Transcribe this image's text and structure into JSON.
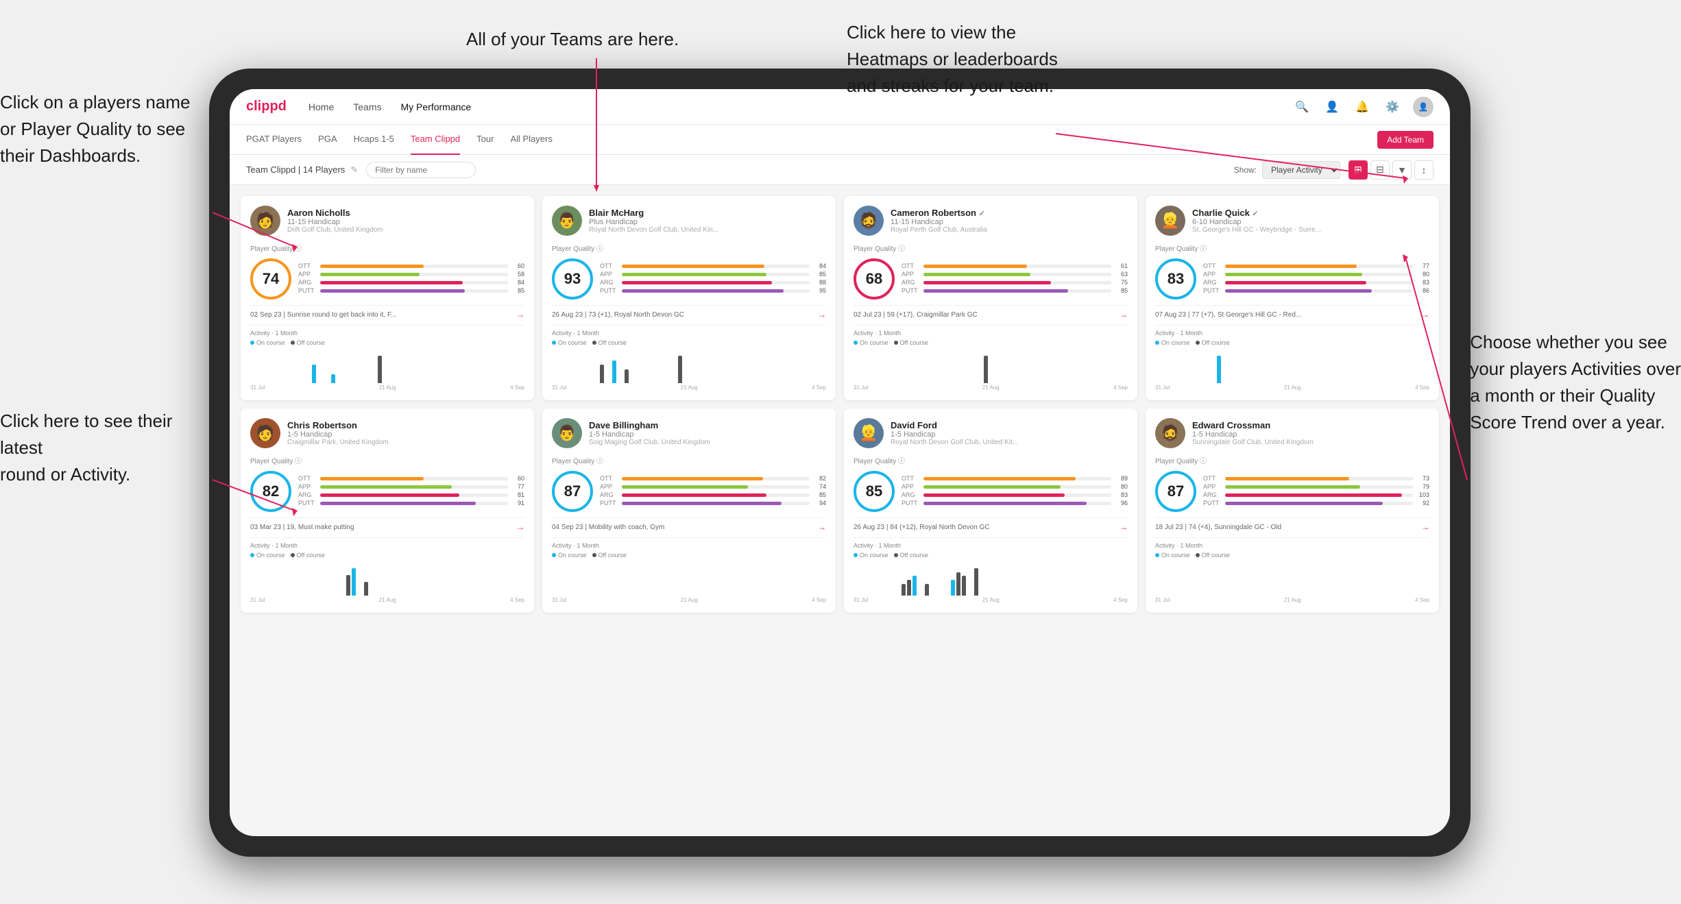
{
  "annotations": {
    "top_center": "All of your Teams are here.",
    "top_right": "Click here to view the\nHeatmaps or leaderboards\nand streaks for your team.",
    "left_top": "Click on a players name\nor Player Quality to see\ntheir Dashboards.",
    "left_bottom": "Click here to see their latest\nround or Activity.",
    "right_bottom": "Choose whether you see\nyour players Activities over\na month or their Quality\nScore Trend over a year."
  },
  "nav": {
    "logo": "clippd",
    "items": [
      "Home",
      "Teams",
      "My Performance"
    ],
    "icons": [
      "search",
      "person",
      "bell",
      "settings",
      "avatar"
    ]
  },
  "sub_nav": {
    "items": [
      "PGAT Players",
      "PGA",
      "Hcaps 1-5",
      "Team Clippd",
      "Tour",
      "All Players"
    ],
    "active": "Team Clippd",
    "add_team_label": "Add Team"
  },
  "toolbar": {
    "team_label": "Team Clippd | 14 Players",
    "filter_placeholder": "Filter by name",
    "show_label": "Show:",
    "show_option": "Player Activity",
    "view_modes": [
      "grid4",
      "grid3",
      "filter",
      "sort"
    ]
  },
  "players": [
    {
      "name": "Aaron Nicholls",
      "handicap": "11-15 Handicap",
      "club": "Drift Golf Club, United Kingdom",
      "quality": 74,
      "ott": 60,
      "app": 58,
      "arg": 84,
      "putt": 85,
      "latest_round": "02 Sep 23 | Sunrise round to get back into it, F...",
      "avatar_color": "#8B7355",
      "chart_bars": [
        0,
        0,
        0,
        0,
        0,
        0,
        0,
        0,
        0,
        2,
        0,
        0,
        1,
        0,
        0,
        0,
        0,
        0,
        0,
        3,
        0
      ]
    },
    {
      "name": "Blair McHarg",
      "handicap": "Plus Handicap",
      "club": "Royal North Devon Golf Club, United Kin...",
      "quality": 93,
      "ott": 84,
      "app": 85,
      "arg": 88,
      "putt": 95,
      "latest_round": "26 Aug 23 | 73 (+1), Royal North Devon GC",
      "avatar_color": "#6B8E5E",
      "chart_bars": [
        0,
        0,
        0,
        0,
        0,
        0,
        0,
        4,
        0,
        5,
        0,
        3,
        0,
        0,
        0,
        0,
        0,
        0,
        0,
        6,
        0
      ]
    },
    {
      "name": "Cameron Robertson",
      "handicap": "11-15 Handicap",
      "club": "Royal Perth Golf Club, Australia",
      "quality": 68,
      "ott": 61,
      "app": 63,
      "arg": 75,
      "putt": 85,
      "latest_round": "02 Jul 23 | 59 (+17), Craigmillar Park GC",
      "avatar_color": "#5B7FA6",
      "chart_bars": [
        0,
        0,
        0,
        0,
        0,
        0,
        0,
        0,
        0,
        0,
        0,
        0,
        0,
        0,
        0,
        0,
        0,
        0,
        0,
        2,
        0
      ]
    },
    {
      "name": "Charlie Quick",
      "handicap": "6-10 Handicap",
      "club": "St. George's Hill GC - Weybridge - Surre...",
      "quality": 83,
      "ott": 77,
      "app": 80,
      "arg": 83,
      "putt": 86,
      "latest_round": "07 Aug 23 | 77 (+7), St George's Hill GC - Red...",
      "avatar_color": "#7B6B5A",
      "chart_bars": [
        0,
        0,
        0,
        0,
        0,
        0,
        0,
        0,
        0,
        3,
        0,
        0,
        0,
        0,
        0,
        0,
        0,
        0,
        0,
        0,
        0
      ]
    },
    {
      "name": "Chris Robertson",
      "handicap": "1-5 Handicap",
      "club": "Craigmillar Park, United Kingdom",
      "quality": 82,
      "ott": 60,
      "app": 77,
      "arg": 81,
      "putt": 91,
      "latest_round": "03 Mar 23 | 19, Must make putting",
      "avatar_color": "#A0522D",
      "chart_bars": [
        0,
        0,
        0,
        0,
        0,
        0,
        0,
        0,
        0,
        0,
        0,
        0,
        0,
        0,
        3,
        4,
        0,
        2,
        0,
        0,
        0
      ]
    },
    {
      "name": "Dave Billingham",
      "handicap": "1-5 Handicap",
      "club": "Soig Maging Golf Club, United Kingdom",
      "quality": 87,
      "ott": 82,
      "app": 74,
      "arg": 85,
      "putt": 94,
      "latest_round": "04 Sep 23 | Mobility with coach, Gym",
      "avatar_color": "#6B8E7A",
      "chart_bars": [
        0,
        0,
        0,
        0,
        0,
        0,
        0,
        0,
        0,
        0,
        0,
        0,
        0,
        0,
        0,
        0,
        0,
        0,
        0,
        0,
        0
      ]
    },
    {
      "name": "David Ford",
      "handicap": "1-5 Handicap",
      "club": "Royal North Devon Golf Club, United Kit...",
      "quality": 85,
      "ott": 89,
      "app": 80,
      "arg": 83,
      "putt": 96,
      "latest_round": "26 Aug 23 | 84 (+12), Royal North Devon GC",
      "avatar_color": "#5A7A9A",
      "chart_bars": [
        0,
        0,
        0,
        0,
        0,
        0,
        0,
        3,
        4,
        5,
        0,
        3,
        0,
        0,
        0,
        4,
        6,
        5,
        0,
        7,
        0
      ]
    },
    {
      "name": "Edward Crossman",
      "handicap": "1-5 Handicap",
      "club": "Sunningdale Golf Club, United Kingdom",
      "quality": 87,
      "ott": 73,
      "app": 79,
      "arg": 103,
      "putt": 92,
      "latest_round": "18 Jul 23 | 74 (+4), Sunningdale GC - Old",
      "avatar_color": "#8B7355",
      "chart_bars": [
        0,
        0,
        0,
        0,
        0,
        0,
        0,
        0,
        0,
        0,
        0,
        0,
        0,
        0,
        0,
        0,
        0,
        0,
        0,
        0,
        0
      ]
    }
  ]
}
